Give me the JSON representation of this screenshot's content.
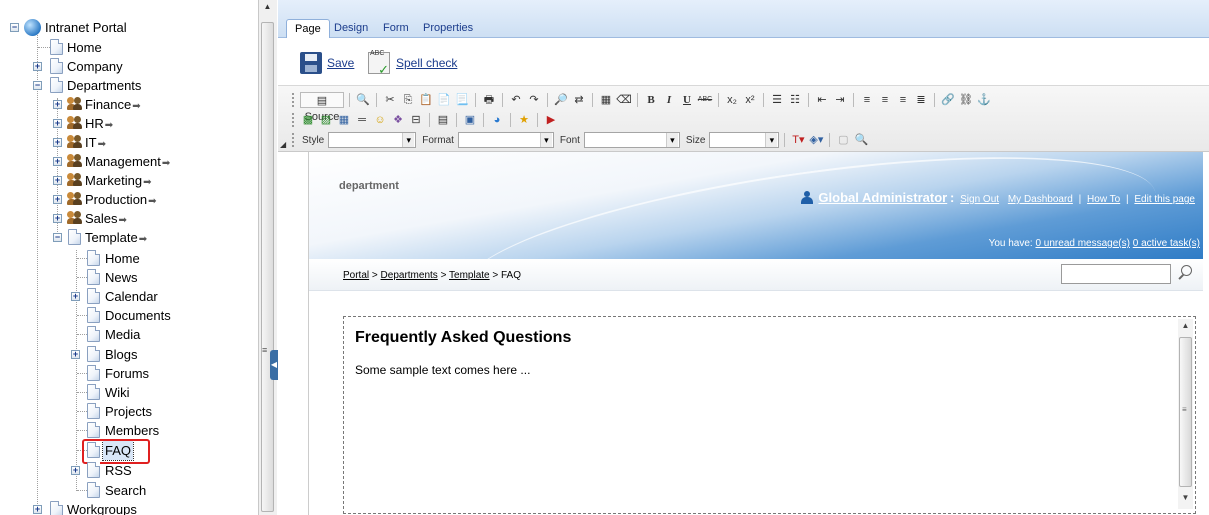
{
  "tree": {
    "root": "Intranet Portal",
    "home": "Home",
    "company": "Company",
    "departments": "Departments",
    "finance": "Finance",
    "hr": "HR",
    "it": "IT",
    "management": "Management",
    "marketing": "Marketing",
    "production": "Production",
    "sales": "Sales",
    "template": "Template",
    "t_home": "Home",
    "t_news": "News",
    "t_calendar": "Calendar",
    "t_documents": "Documents",
    "t_media": "Media",
    "t_blogs": "Blogs",
    "t_forums": "Forums",
    "t_wiki": "Wiki",
    "t_projects": "Projects",
    "t_members": "Members",
    "t_faq": "FAQ",
    "t_rss": "RSS",
    "t_search": "Search",
    "workgroups": "Workgroups",
    "expand_glyph": "+",
    "collapse_glyph": "−",
    "arrow_glyph": "➡"
  },
  "tabs": [
    "Page",
    "Design",
    "Form",
    "Properties"
  ],
  "actions": {
    "save": "Save",
    "spell_check": "Spell check"
  },
  "toolbar": {
    "source": "Source",
    "style": "Style",
    "format": "Format",
    "font": "Font",
    "size": "Size",
    "bold": "B",
    "italic": "I",
    "underline": "U",
    "strike": "ABC",
    "sub": "x₂",
    "sup": "x²"
  },
  "preview": {
    "department": "department",
    "user_name": "Global Administrator",
    "user_sep": ":",
    "sign_out": "Sign Out",
    "dashboard": "My Dashboard",
    "how_to": "How To",
    "edit_page": "Edit this page",
    "pipe": "|",
    "you_have": "You have:",
    "unread": "0 unread message(s)",
    "tasks": "0 active task(s)",
    "crumb_portal": "Portal",
    "crumb_departments": "Departments",
    "crumb_template": "Template",
    "crumb_current": "FAQ",
    "crumb_sep": ">",
    "faq_title": "Frequently Asked Questions",
    "faq_text": "Some sample text comes here ..."
  },
  "colors": {
    "accent": "#1b3c8c",
    "highlight": "#e02020",
    "banner": "#2f7cc6"
  }
}
